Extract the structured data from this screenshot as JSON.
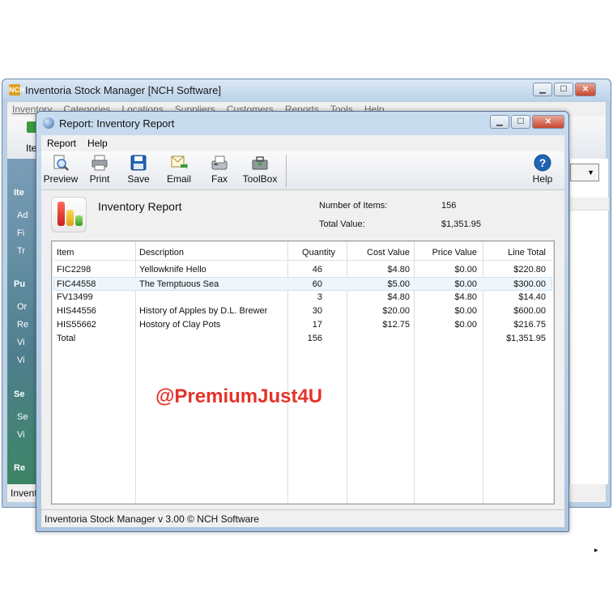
{
  "main_window": {
    "title": "Inventoria Stock Manager [NCH Software]",
    "app_icon": "NCH",
    "menu": [
      "Inventory",
      "Categories",
      "Locations",
      "Suppliers",
      "Customers",
      "Reports",
      "Tools",
      "Help"
    ],
    "toolbar_partial": "Ite",
    "sidebar": {
      "sections": [
        {
          "head": "Ite",
          "items": [
            "Ad",
            "Fi",
            "Tr"
          ]
        },
        {
          "head": "Pu",
          "items": [
            "Or",
            "Re",
            "Vi",
            "Vi"
          ]
        },
        {
          "head": "Se",
          "items": [
            "Se",
            "Vi"
          ]
        },
        {
          "head": "Re",
          "items": []
        }
      ]
    },
    "status_partial": "Invent"
  },
  "report_window": {
    "title": "Report: Inventory Report",
    "menu": [
      "Report",
      "Help"
    ],
    "toolbar": [
      "Preview",
      "Print",
      "Save",
      "Email",
      "Fax",
      "ToolBox"
    ],
    "help_label": "Help",
    "report_name": "Inventory Report",
    "items_label": "Number of Items:",
    "items_value": "156",
    "total_label": "Total Value:",
    "total_value": "$1,351.95",
    "table": {
      "columns": [
        "Item",
        "Description",
        "Quantity",
        "Cost Value",
        "Price Value",
        "Line Total"
      ],
      "rows": [
        [
          "FIC2298",
          "Yellowknife Hello",
          "46",
          "$4.80",
          "$0.00",
          "$220.80"
        ],
        [
          "FIC44558",
          "The Temptuous Sea",
          "60",
          "$5.00",
          "$0.00",
          "$300.00"
        ],
        [
          "FV13499",
          "",
          "3",
          "$4.80",
          "$4.80",
          "$14.40"
        ],
        [
          "HIS44556",
          "History of Apples by D.L. Brewer",
          "30",
          "$20.00",
          "$0.00",
          "$600.00"
        ],
        [
          "HIS55662",
          "Hostory of Clay Pots",
          "17",
          "$12.75",
          "$0.00",
          "$216.75"
        ],
        [
          "Total",
          "",
          "156",
          "",
          "",
          "$1,351.95"
        ]
      ]
    },
    "status": "Inventoria Stock Manager v 3.00 © NCH Software"
  },
  "watermark": "@PremiumJust4U"
}
